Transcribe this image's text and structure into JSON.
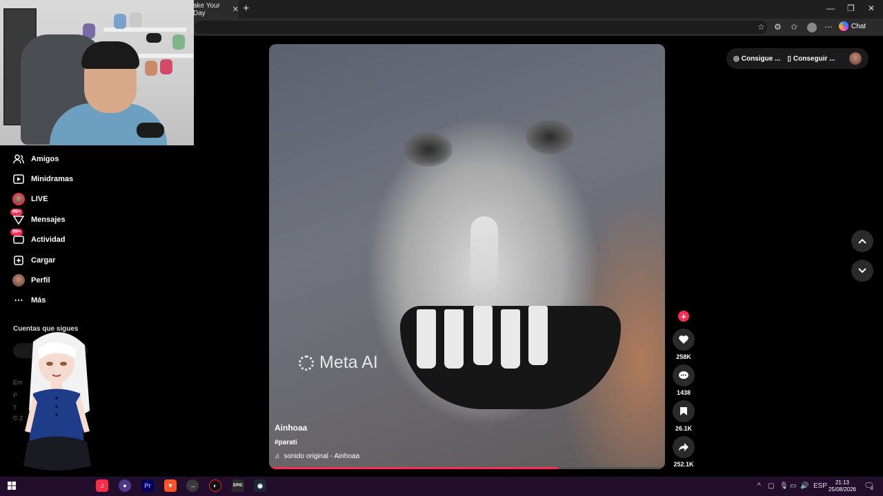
{
  "browser": {
    "tab_title": "ake Your Day",
    "tab_close": "✕",
    "new_tab": "+",
    "chat_label": "Chat",
    "window": {
      "minimize": "—",
      "restore": "❐",
      "close": "✕"
    }
  },
  "sidebar": {
    "items": [
      {
        "label": "Amigos",
        "icon": "friends-icon",
        "glyph": "👥"
      },
      {
        "label": "Minidramas",
        "icon": "film-icon",
        "glyph": "▣"
      },
      {
        "label": "LIVE",
        "icon": "live-avatar"
      },
      {
        "label": "Mensajes",
        "icon": "messages-icon",
        "glyph": "✈",
        "badge": "99+"
      },
      {
        "label": "Actividad",
        "icon": "activity-icon",
        "glyph": "✉",
        "badge": "99+"
      },
      {
        "label": "Cargar",
        "icon": "upload-icon",
        "glyph": "⊞"
      },
      {
        "label": "Perfil",
        "icon": "profile-avatar"
      },
      {
        "label": "Más",
        "icon": "more-icon",
        "glyph": "⋯"
      }
    ],
    "following_title": "Cuentas que sigues",
    "footer": [
      "Em",
      "P",
      "T",
      "© 2"
    ]
  },
  "video": {
    "watermark": "Meta AI",
    "author": "Ainhoaa",
    "hashtag": "#parati",
    "sound": "sonido original - Ainhoaa",
    "progress": 0.73
  },
  "actions": {
    "likes": "258K",
    "comments": "1438",
    "saves": "26.1K",
    "shares": "252.1K"
  },
  "top_right": {
    "cta1": "Consigue ...",
    "cta2": "Conseguir ..."
  },
  "taskbar": {
    "language": "ESP",
    "time": "21:13",
    "date": "25/08/2026",
    "notifications": "3"
  }
}
